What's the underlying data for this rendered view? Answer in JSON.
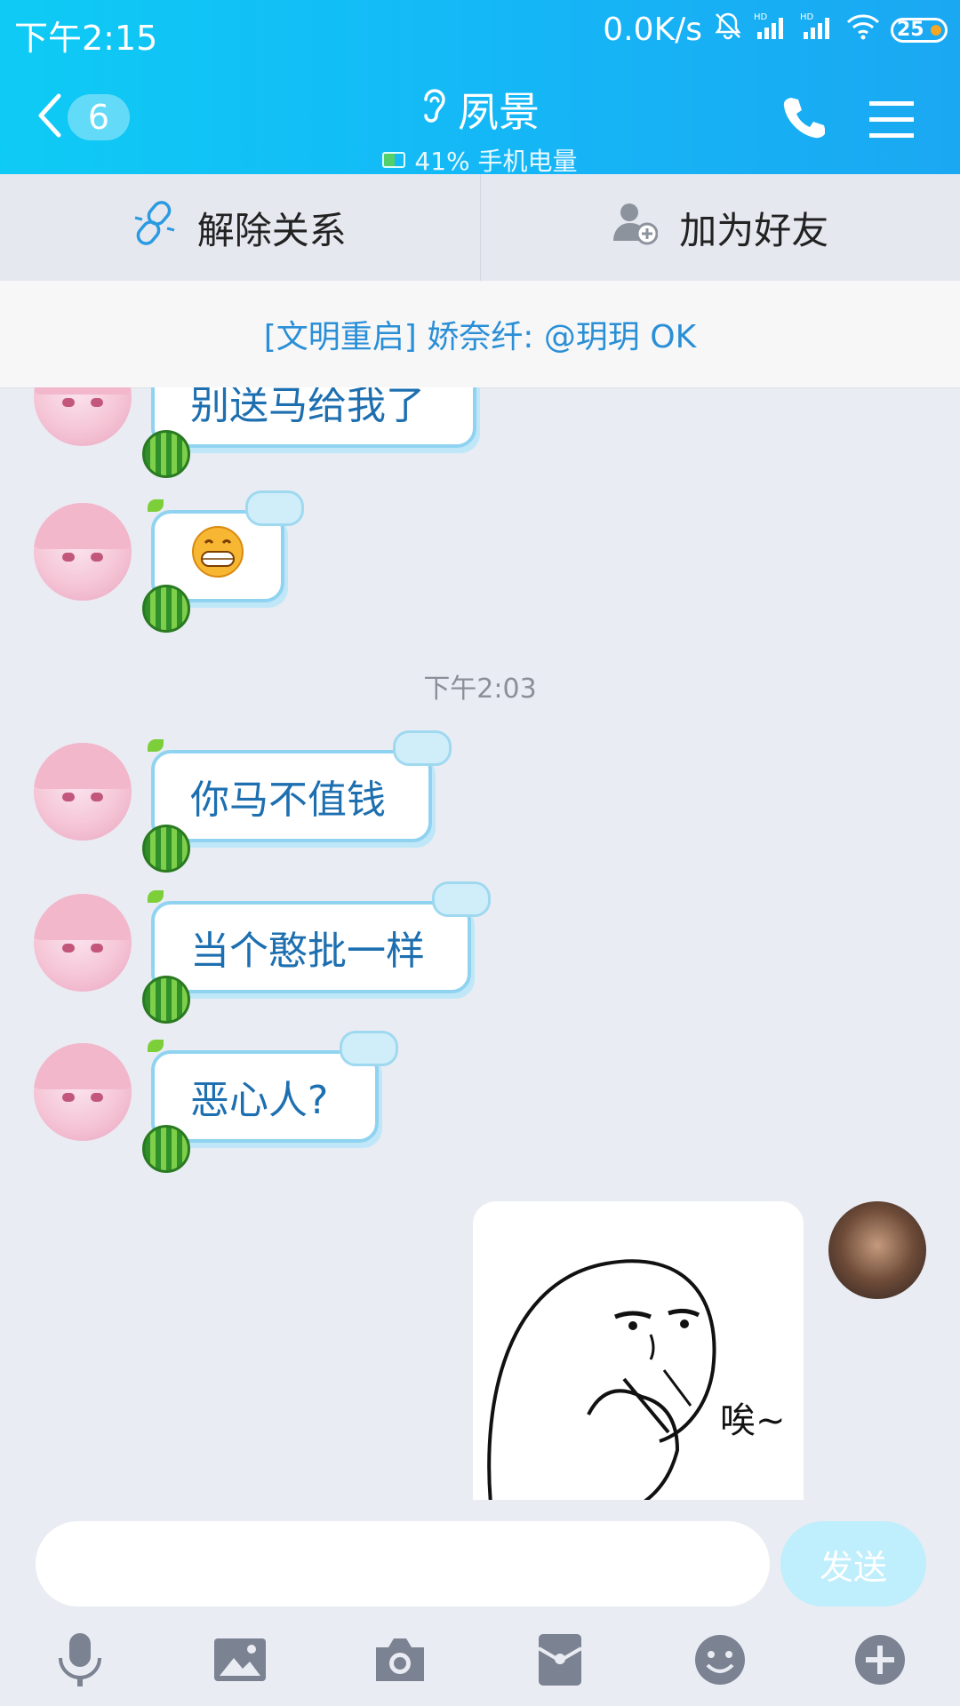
{
  "status_bar": {
    "time": "下午2:15",
    "speed": "0.0K/s",
    "battery": "25",
    "icons": [
      "mute-bell-icon",
      "hd-signal-icon",
      "hd-signal-icon",
      "wifi-icon",
      "battery-icon"
    ]
  },
  "header": {
    "back_badge": "6",
    "title": "夙景",
    "subtitle": "41% 手机电量",
    "colors": {
      "gradient_start": "#0ecbf5",
      "gradient_end": "#1aa8f2"
    }
  },
  "actions": {
    "unlink_label": "解除关系",
    "add_friend_label": "加为好友"
  },
  "notice": {
    "text": "[文明重启] 娇奈纤: @玥玥 OK"
  },
  "messages": [
    {
      "text": "别送马给我了"
    },
    {
      "text": "",
      "emoji": "grin-emoji"
    },
    {
      "timestamp": "下午2:03"
    },
    {
      "text": "你马不值钱"
    },
    {
      "text": "当个憨批一样"
    },
    {
      "text": "恶心人?"
    },
    {
      "sticker_text": "唉~"
    }
  ],
  "input": {
    "placeholder": "",
    "send_label": "发送"
  },
  "toolbar": {
    "icons": [
      "microphone-icon",
      "image-icon",
      "camera-icon",
      "red-packet-icon",
      "emoji-icon",
      "plus-icon"
    ]
  }
}
